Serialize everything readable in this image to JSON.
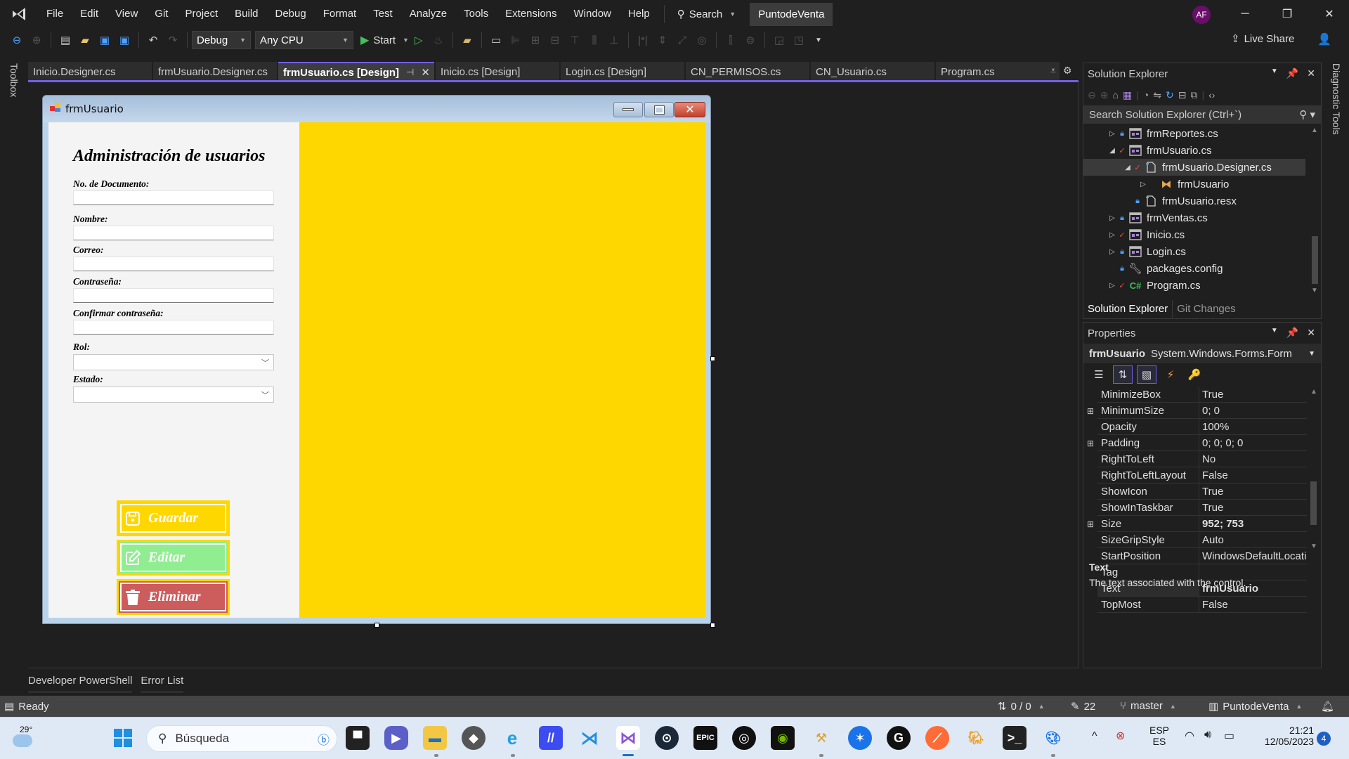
{
  "titlebar": {
    "menu": [
      "File",
      "Edit",
      "View",
      "Git",
      "Project",
      "Build",
      "Debug",
      "Format",
      "Test",
      "Analyze",
      "Tools",
      "Extensions",
      "Window",
      "Help"
    ],
    "search_label": "Search",
    "solution_name": "PuntodeVenta",
    "avatar_initials": "AF"
  },
  "toolbar": {
    "configuration": "Debug",
    "platform": "Any CPU",
    "start_label": "Start",
    "live_share_label": "Live Share"
  },
  "toolbox_label": "Toolbox",
  "diagnostic_tools_label": "Diagnostic Tools",
  "doc_tabs": [
    {
      "label": "Inicio.Designer.cs",
      "active": false
    },
    {
      "label": "frmUsuario.Designer.cs",
      "active": false
    },
    {
      "label": "frmUsuario.cs [Design]",
      "active": true
    },
    {
      "label": "Inicio.cs [Design]",
      "active": false
    },
    {
      "label": "Login.cs [Design]",
      "active": false
    },
    {
      "label": "CN_PERMISOS.cs",
      "active": false
    },
    {
      "label": "CN_Usuario.cs",
      "active": false
    },
    {
      "label": "Program.cs",
      "active": false
    }
  ],
  "form": {
    "title": "frmUsuario",
    "heading": "Administración de usuarios",
    "fields": [
      {
        "label": "No. de Documento:",
        "type": "text",
        "value": ""
      },
      {
        "label": "Nombre:",
        "type": "text",
        "value": ""
      },
      {
        "label": "Correo:",
        "type": "text",
        "value": ""
      },
      {
        "label": "Contraseña:",
        "type": "text",
        "value": ""
      },
      {
        "label": "Confirmar contraseña:",
        "type": "text",
        "value": ""
      },
      {
        "label": "Rol:",
        "type": "combo",
        "value": ""
      },
      {
        "label": "Estado:",
        "type": "combo",
        "value": ""
      }
    ],
    "buttons": [
      {
        "label": "Guardar",
        "icon": "save-icon",
        "color": "#ffd700"
      },
      {
        "label": "Editar",
        "icon": "edit-icon",
        "color": "#90ee90"
      },
      {
        "label": "Eliminar",
        "icon": "trash-icon",
        "color": "#cd5c5c"
      }
    ],
    "panel_color": "#ffd700"
  },
  "solution_explorer": {
    "title": "Solution Explorer",
    "search_placeholder": "Search Solution Explorer (Ctrl+`)",
    "items": [
      {
        "label": "frmReportes.cs",
        "status": "lock",
        "expander": "collapsed",
        "icon": "form-icon",
        "level": 0
      },
      {
        "label": "frmUsuario.cs",
        "status": "check",
        "expander": "expanded",
        "icon": "form-icon",
        "level": 0
      },
      {
        "label": "frmUsuario.Designer.cs",
        "status": "check",
        "expander": "expanded",
        "icon": "file-icon",
        "level": 1,
        "selected": true
      },
      {
        "label": "frmUsuario",
        "status": "",
        "expander": "collapsed",
        "icon": "class-icon",
        "level": 2
      },
      {
        "label": "frmUsuario.resx",
        "status": "lock",
        "expander": "",
        "icon": "file-icon",
        "level": 1
      },
      {
        "label": "frmVentas.cs",
        "status": "lock",
        "expander": "collapsed",
        "icon": "form-icon",
        "level": 0
      },
      {
        "label": "Inicio.cs",
        "status": "check",
        "expander": "collapsed",
        "icon": "form-icon",
        "level": 0
      },
      {
        "label": "Login.cs",
        "status": "lock",
        "expander": "collapsed",
        "icon": "form-icon",
        "level": 0
      },
      {
        "label": "packages.config",
        "status": "lock",
        "expander": "",
        "icon": "config-icon",
        "level": 0
      },
      {
        "label": "Program.cs",
        "status": "check",
        "expander": "collapsed",
        "icon": "csharp-icon",
        "level": 0
      }
    ],
    "bottom_tabs": [
      "Solution Explorer",
      "Git Changes"
    ]
  },
  "properties": {
    "title": "Properties",
    "object_name": "frmUsuario",
    "object_type": "System.Windows.Forms.Form",
    "rows": [
      {
        "name": "MinimizeBox",
        "value": "True",
        "expandable": false,
        "bold": false
      },
      {
        "name": "MinimumSize",
        "value": "0; 0",
        "expandable": true,
        "bold": false
      },
      {
        "name": "Opacity",
        "value": "100%",
        "expandable": false,
        "bold": false
      },
      {
        "name": "Padding",
        "value": "0; 0; 0; 0",
        "expandable": true,
        "bold": false
      },
      {
        "name": "RightToLeft",
        "value": "No",
        "expandable": false,
        "bold": false
      },
      {
        "name": "RightToLeftLayout",
        "value": "False",
        "expandable": false,
        "bold": false
      },
      {
        "name": "ShowIcon",
        "value": "True",
        "expandable": false,
        "bold": false
      },
      {
        "name": "ShowInTaskbar",
        "value": "True",
        "expandable": false,
        "bold": false
      },
      {
        "name": "Size",
        "value": "952; 753",
        "expandable": true,
        "bold": true
      },
      {
        "name": "SizeGripStyle",
        "value": "Auto",
        "expandable": false,
        "bold": false
      },
      {
        "name": "StartPosition",
        "value": "WindowsDefaultLocati",
        "expandable": false,
        "bold": false
      },
      {
        "name": "Tag",
        "value": "",
        "expandable": false,
        "bold": false
      },
      {
        "name": "Text",
        "value": "frmUsuario",
        "expandable": false,
        "bold": true,
        "selected": true
      },
      {
        "name": "TopMost",
        "value": "False",
        "expandable": false,
        "bold": false
      }
    ],
    "description_title": "Text",
    "description_text": "The text associated with the control."
  },
  "output_tabs": [
    "Developer PowerShell",
    "Error List"
  ],
  "statusbar": {
    "status": "Ready",
    "sync": "0 / 0",
    "pending_changes": "22",
    "branch": "master",
    "repo": "PuntodeVenta"
  },
  "taskbar": {
    "weather": "29°",
    "search_placeholder": "Búsqueda",
    "language_top": "ESP",
    "language_bottom": "ES",
    "time": "21:21",
    "date": "12/05/2023",
    "notifications": "4"
  }
}
